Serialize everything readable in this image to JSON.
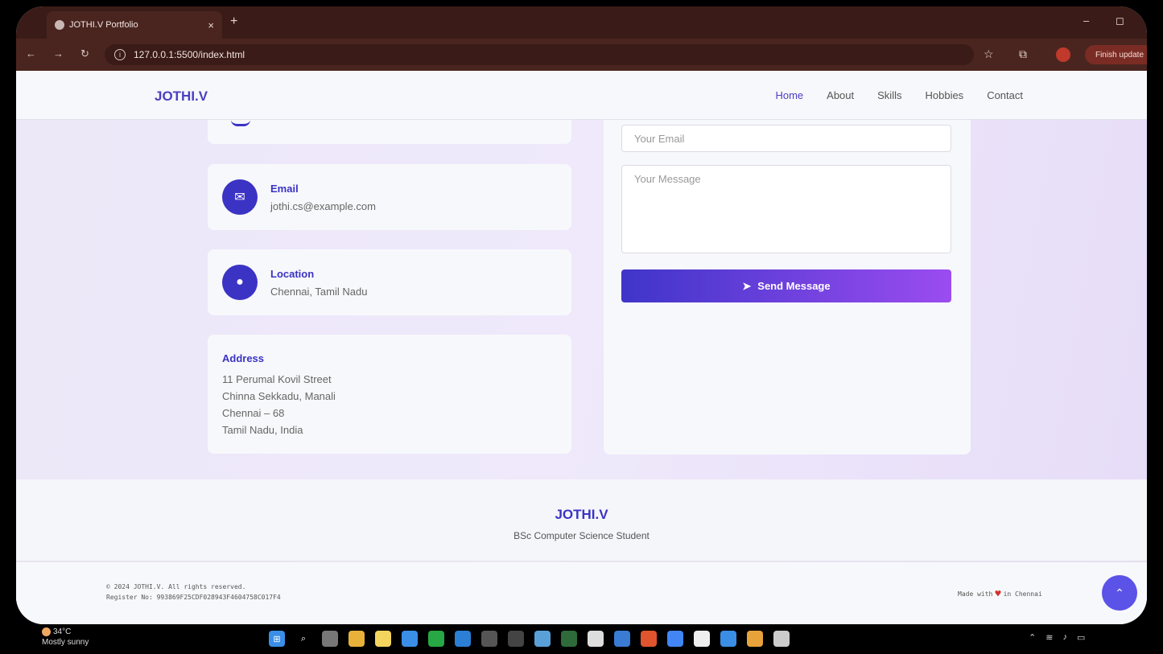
{
  "browser": {
    "tab_title": "JOTHI.V Portfolio",
    "tab_close": "×",
    "new_tab": "+",
    "minimize": "–",
    "restore": "◻",
    "url": "127.0.0.1:5500/index.html",
    "update_label": "Finish update"
  },
  "nav": {
    "brand": "JOTHI.V",
    "links": [
      "Home",
      "About",
      "Skills",
      "Hobbies",
      "Contact"
    ],
    "active": "Home"
  },
  "contact": {
    "email": {
      "title": "Email",
      "value": "jothi.cs@example.com",
      "icon": "envelope-icon"
    },
    "location": {
      "title": "Location",
      "value": "Chennai, Tamil Nadu",
      "icon": "map-pin-icon"
    },
    "address": {
      "title": "Address",
      "lines": [
        "11 Perumal Kovil Street",
        "Chinna Sekkadu, Manali",
        "Chennai – 68",
        "Tamil Nadu, India"
      ]
    }
  },
  "form": {
    "email_placeholder": "Your Email",
    "message_placeholder": "Your Message",
    "send_label": "Send Message"
  },
  "footer": {
    "brand": "JOTHI.V",
    "subtitle": "BSc Computer Science Student",
    "copyright": "© 2024 JOTHI.V. All rights reserved.",
    "register": "Register No: 993869F25CDF028943F4604758C017F4",
    "made_prefix": "Made with",
    "made_suffix": "in Chennai"
  },
  "taskbar": {
    "temp": "34°C",
    "condition": "Mostly sunny"
  },
  "colors": {
    "accent": "#3b33c4",
    "brand": "#4b3fc4",
    "button_from": "#3f35c9",
    "button_to": "#9b4cf0"
  }
}
